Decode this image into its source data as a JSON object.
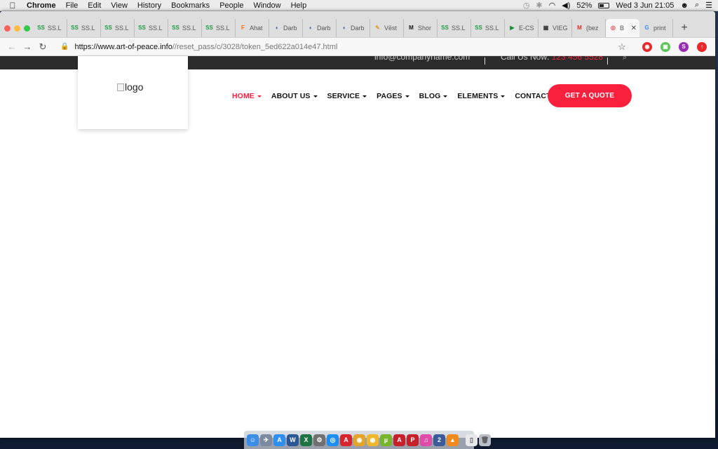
{
  "menubar": {
    "app_name": "Chrome",
    "menus": [
      "File",
      "Edit",
      "View",
      "History",
      "Bookmarks",
      "People",
      "Window",
      "Help"
    ],
    "battery_percent": "52%",
    "battery_level": 0.52,
    "clock": "Wed 3 Jun  21:05",
    "status_icons": [
      "time-machine-icon",
      "bluetooth-icon",
      "wifi-icon",
      "volume-icon",
      "battery-icon",
      "user-icon",
      "spotlight-icon",
      "notification-center-icon"
    ]
  },
  "tabs": [
    {
      "favicon": "SS",
      "fav_color": "#1a9b3a",
      "label": "SS.L"
    },
    {
      "favicon": "SS",
      "fav_color": "#1a9b3a",
      "label": "SS.L"
    },
    {
      "favicon": "SS",
      "fav_color": "#1a9b3a",
      "label": "SS.L"
    },
    {
      "favicon": "SS",
      "fav_color": "#1a9b3a",
      "label": "SS.L"
    },
    {
      "favicon": "SS",
      "fav_color": "#1a9b3a",
      "label": "SS.L"
    },
    {
      "favicon": "SS",
      "fav_color": "#1a9b3a",
      "label": "SS.L"
    },
    {
      "favicon": "F",
      "fav_color": "#f26a1b",
      "label": "Ahat"
    },
    {
      "favicon": "◖",
      "fav_color": "#2a5fb0",
      "label": "Darb"
    },
    {
      "favicon": "◖",
      "fav_color": "#2a5fb0",
      "label": "Darb"
    },
    {
      "favicon": "◖",
      "fav_color": "#2a5fb0",
      "label": "Darb"
    },
    {
      "favicon": "✎",
      "fav_color": "#d9a43b",
      "label": "Vēst"
    },
    {
      "favicon": "M",
      "fav_color": "#111111",
      "label": "Shor"
    },
    {
      "favicon": "SS",
      "fav_color": "#1a9b3a",
      "label": "SS.L"
    },
    {
      "favicon": "SS",
      "fav_color": "#1a9b3a",
      "label": "SS.L"
    },
    {
      "favicon": "▶",
      "fav_color": "#1a8a3a",
      "label": "E-CS"
    },
    {
      "favicon": "▦",
      "fav_color": "#333333",
      "label": "VIEG"
    },
    {
      "favicon": "M",
      "fav_color": "#d93025",
      "label": "(bez"
    },
    {
      "favicon": "◎",
      "fav_color": "#e8444c",
      "label": "B",
      "active": true
    },
    {
      "favicon": "G",
      "fav_color": "#4285f4",
      "label": "print"
    }
  ],
  "toolbar": {
    "back": "←",
    "forward": "→",
    "reload": "↻",
    "url_host": "https://www.art-of-peace.info",
    "url_path": "//reset_pass/c/3028/token_5ed622a014e47.html",
    "star": "☆",
    "extensions": [
      {
        "name": "ext-red-icon",
        "color": "#e8262b",
        "glyph": "◉"
      },
      {
        "name": "ext-green-icon",
        "color": "#5ac45a",
        "glyph": "▣"
      },
      {
        "name": "profile-avatar",
        "color": "#9b2bb5",
        "glyph": "S"
      },
      {
        "name": "ext-update-icon",
        "color": "#e8262b",
        "glyph": "↑"
      }
    ]
  },
  "site": {
    "topbar": {
      "email": "info@companyname.com",
      "call_label": "Call Us Now: ",
      "phone": "123 456 5528",
      "search_glyph": "⌕"
    },
    "logo_alt": "logo",
    "nav": [
      {
        "label": "HOME",
        "dropdown": true,
        "active": true
      },
      {
        "label": "ABOUT US",
        "dropdown": true
      },
      {
        "label": "SERVICE",
        "dropdown": true
      },
      {
        "label": "PAGES",
        "dropdown": true
      },
      {
        "label": "BLOG",
        "dropdown": true
      },
      {
        "label": "ELEMENTS",
        "dropdown": true
      },
      {
        "label": "CONTACT",
        "dropdown": false
      }
    ],
    "cta_label": "GET A QUOTE",
    "accent_color": "#f8203d"
  },
  "dock": [
    {
      "name": "finder-icon",
      "color": "#3a8ee6",
      "glyph": "☺"
    },
    {
      "name": "launchpad-icon",
      "color": "#7c8aa0",
      "glyph": "✈"
    },
    {
      "name": "app-store-icon",
      "color": "#2f8ff0",
      "glyph": "A"
    },
    {
      "name": "word-icon",
      "color": "#2b5797",
      "glyph": "W"
    },
    {
      "name": "excel-icon",
      "color": "#1f7244",
      "glyph": "X"
    },
    {
      "name": "system-preferences-icon",
      "color": "#707070",
      "glyph": "⚙"
    },
    {
      "name": "safari-icon",
      "color": "#1c8ef2",
      "glyph": "◎"
    },
    {
      "name": "acrobat-icon",
      "color": "#d8242c",
      "glyph": "A"
    },
    {
      "name": "chrome-icon",
      "color": "#e2a52a",
      "glyph": "◉"
    },
    {
      "name": "chrome-canary-icon",
      "color": "#f0b62c",
      "glyph": "◉"
    },
    {
      "name": "utorrent-icon",
      "color": "#77b52a",
      "glyph": "µ"
    },
    {
      "name": "acrobat-reader-icon",
      "color": "#c8202a",
      "glyph": "A"
    },
    {
      "name": "pdf-icon",
      "color": "#c8202a",
      "glyph": "P"
    },
    {
      "name": "itunes-icon",
      "color": "#e04aa8",
      "glyph": "♫"
    },
    {
      "name": "calendar-2-icon",
      "color": "#3b5a9a",
      "glyph": "2"
    },
    {
      "name": "vlc-icon",
      "color": "#f08a1c",
      "glyph": "▲"
    },
    {
      "name": "document-icon",
      "color": "#e8e8e8",
      "glyph": "▯"
    },
    {
      "name": "trash-icon",
      "color": "#b9bec8",
      "glyph": "🗑"
    }
  ]
}
